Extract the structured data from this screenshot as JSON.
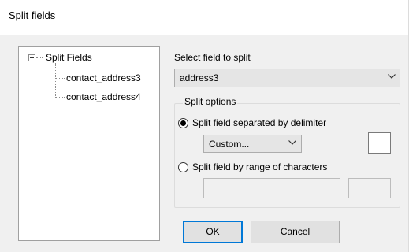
{
  "window": {
    "title": "Split fields"
  },
  "tree": {
    "root_label": "Split Fields",
    "children": [
      "contact_address3",
      "contact_address4"
    ]
  },
  "field_select": {
    "label": "Select field to split",
    "value": "address3"
  },
  "split_options": {
    "legend": "Split options",
    "delimiter_option": {
      "label": "Split field separated by delimiter",
      "checked": true,
      "delimiter_value": "Custom...",
      "custom_delimiter": ""
    },
    "range_option": {
      "label": "Split field by range of characters",
      "checked": false,
      "start": "",
      "end": ""
    }
  },
  "buttons": {
    "ok": "OK",
    "cancel": "Cancel"
  },
  "icons": {
    "tree_toggle": "minus-box-icon",
    "dropdown": "chevron-down-icon"
  },
  "colors": {
    "accent": "#0078d7"
  }
}
